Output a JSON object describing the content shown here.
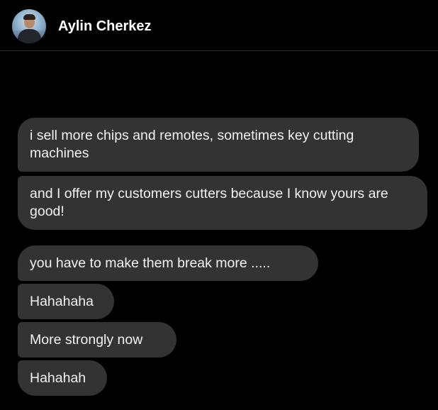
{
  "header": {
    "contact_name": "Aylin Cherkez",
    "avatar_icon": "profile-photo"
  },
  "messages": [
    {
      "text": "i sell more chips and remotes, sometimes key cutting machines"
    },
    {
      "text": "and I offer my customers cutters because I know yours are good!"
    },
    {
      "text": "you have to make them break more ....."
    },
    {
      "text": "Hahahaha"
    },
    {
      "text": "More strongly now"
    },
    {
      "text": "Hahahah"
    }
  ],
  "colors": {
    "background": "#000000",
    "bubble": "#333333",
    "text": "#f2f2f2",
    "divider": "#2a2a2a"
  }
}
